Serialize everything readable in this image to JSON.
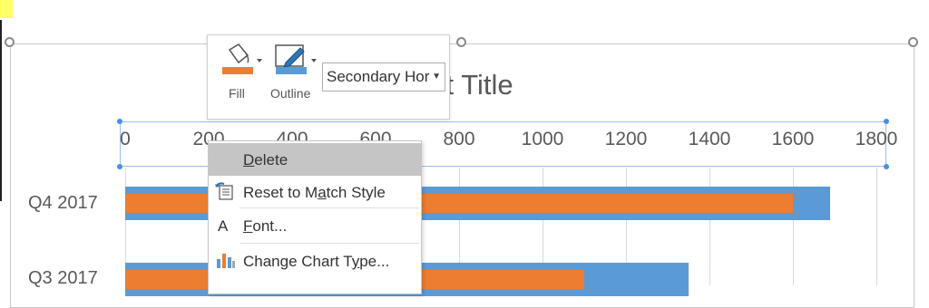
{
  "chart": {
    "title": "Chart Title",
    "axis_ticks": [
      "0",
      "200",
      "400",
      "600",
      "800",
      "1000",
      "1200",
      "1400",
      "1600",
      "1800"
    ],
    "categories": [
      "Q4 2017",
      "Q3 2017"
    ]
  },
  "chart_data": {
    "type": "bar",
    "orientation": "horizontal",
    "title": "Chart Title",
    "categories": [
      "Q4 2017",
      "Q3 2017"
    ],
    "series": [
      {
        "color": "#5b9bd5",
        "values": [
          1690,
          1350
        ]
      },
      {
        "color": "#ed7d31",
        "values": [
          1600,
          1100
        ]
      }
    ],
    "xlim": [
      0,
      1800
    ],
    "grid": true
  },
  "mini_toolbar": {
    "fill_label": "Fill",
    "outline_label": "Outline",
    "fill_icon": "paint-bucket-icon",
    "outline_icon": "pen-outline-icon",
    "element_selector_value": "Secondary Hor"
  },
  "context_menu": {
    "items": [
      {
        "label": "Delete",
        "accel": "D",
        "icon": ""
      },
      {
        "label": "Reset to Match Style",
        "accel": "a",
        "icon": "reset-style-icon"
      },
      {
        "label": "Font...",
        "accel": "F",
        "icon": "font-icon"
      },
      {
        "label": "Change Chart Type...",
        "accel": "y",
        "icon": "chart-type-icon"
      }
    ]
  },
  "colors": {
    "accent_blue": "#5b9bd5",
    "accent_orange": "#ed7d31",
    "selection": "#4a90e2"
  }
}
